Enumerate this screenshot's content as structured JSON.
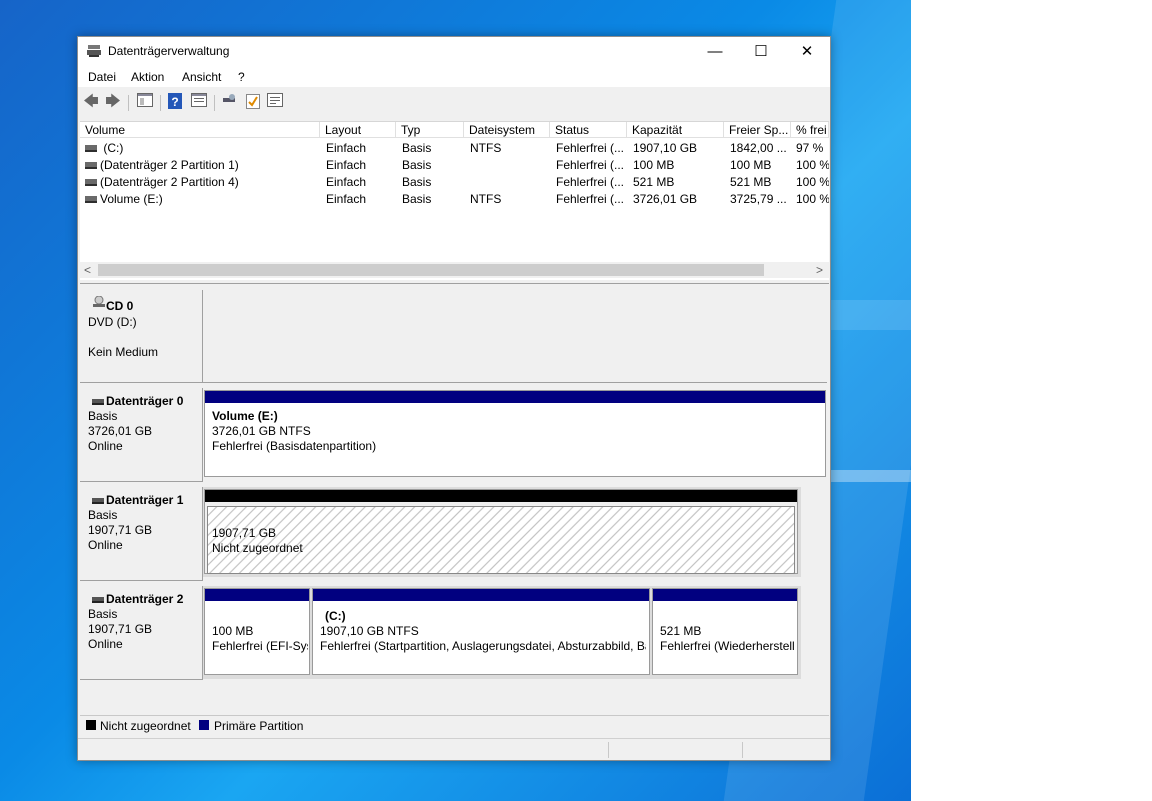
{
  "window": {
    "title": "Datenträgerverwaltung",
    "minimize_glyph": "—",
    "maximize_glyph": "☐",
    "close_glyph": "✕"
  },
  "menu": [
    "Datei",
    "Aktion",
    "Ansicht",
    "?"
  ],
  "toolbar_icons": [
    "back-arrow-icon",
    "forward-arrow-icon",
    "console-tree-icon",
    "help-icon",
    "properties-icon",
    "refresh-icon",
    "check-icon",
    "settings-list-icon"
  ],
  "volume_list": {
    "columns": [
      "Volume",
      "Layout",
      "Typ",
      "Dateisystem",
      "Status",
      "Kapazität",
      "Freier Sp...",
      "% frei"
    ],
    "rows": [
      [
        "(C:)",
        "Einfach",
        "Basis",
        "NTFS",
        "Fehlerfrei (...",
        "1907,10 GB",
        "1842,00 ...",
        "97 %"
      ],
      [
        "(Datenträger 2 Partition 1)",
        "Einfach",
        "Basis",
        "",
        "Fehlerfrei (...",
        "100 MB",
        "100 MB",
        "100 %"
      ],
      [
        "(Datenträger 2 Partition 4)",
        "Einfach",
        "Basis",
        "",
        "Fehlerfrei (...",
        "521 MB",
        "521 MB",
        "100 %"
      ],
      [
        "Volume (E:)",
        "Einfach",
        "Basis",
        "NTFS",
        "Fehlerfrei (...",
        "3726,01 GB",
        "3725,79 ...",
        "100 %"
      ]
    ]
  },
  "scroll": {
    "left": "<",
    "right": ">"
  },
  "disks": {
    "cd0": {
      "name": "CD 0",
      "line1": "DVD (D:)",
      "line2": "Kein Medium"
    },
    "d0": {
      "name": "Datenträger 0",
      "type": "Basis",
      "size": "3726,01 GB",
      "state": "Online",
      "part": {
        "title": "Volume  (E:)",
        "line1": "3726,01 GB NTFS",
        "line2": "Fehlerfrei (Basisdatenpartition)"
      }
    },
    "d1": {
      "name": "Datenträger 1",
      "type": "Basis",
      "size": "1907,71 GB",
      "state": "Online",
      "part": {
        "line1": "1907,71 GB",
        "line2": "Nicht zugeordnet"
      }
    },
    "d2": {
      "name": "Datenträger 2",
      "type": "Basis",
      "size": "1907,71 GB",
      "state": "Online",
      "parts": [
        {
          "title": "",
          "line1": "100 MB",
          "line2": "Fehlerfrei (EFI-Sys"
        },
        {
          "title": "(C:)",
          "line1": "1907,10 GB NTFS",
          "line2": "Fehlerfrei (Startpartition, Auslagerungsdatei, Absturzabbild, Ba"
        },
        {
          "title": "",
          "line1": "521 MB",
          "line2": "Fehlerfrei (Wiederherstell"
        }
      ]
    }
  },
  "legend": [
    {
      "label": "Nicht zugeordnet",
      "color": "#000000"
    },
    {
      "label": "Primäre Partition",
      "color": "#010080"
    }
  ]
}
